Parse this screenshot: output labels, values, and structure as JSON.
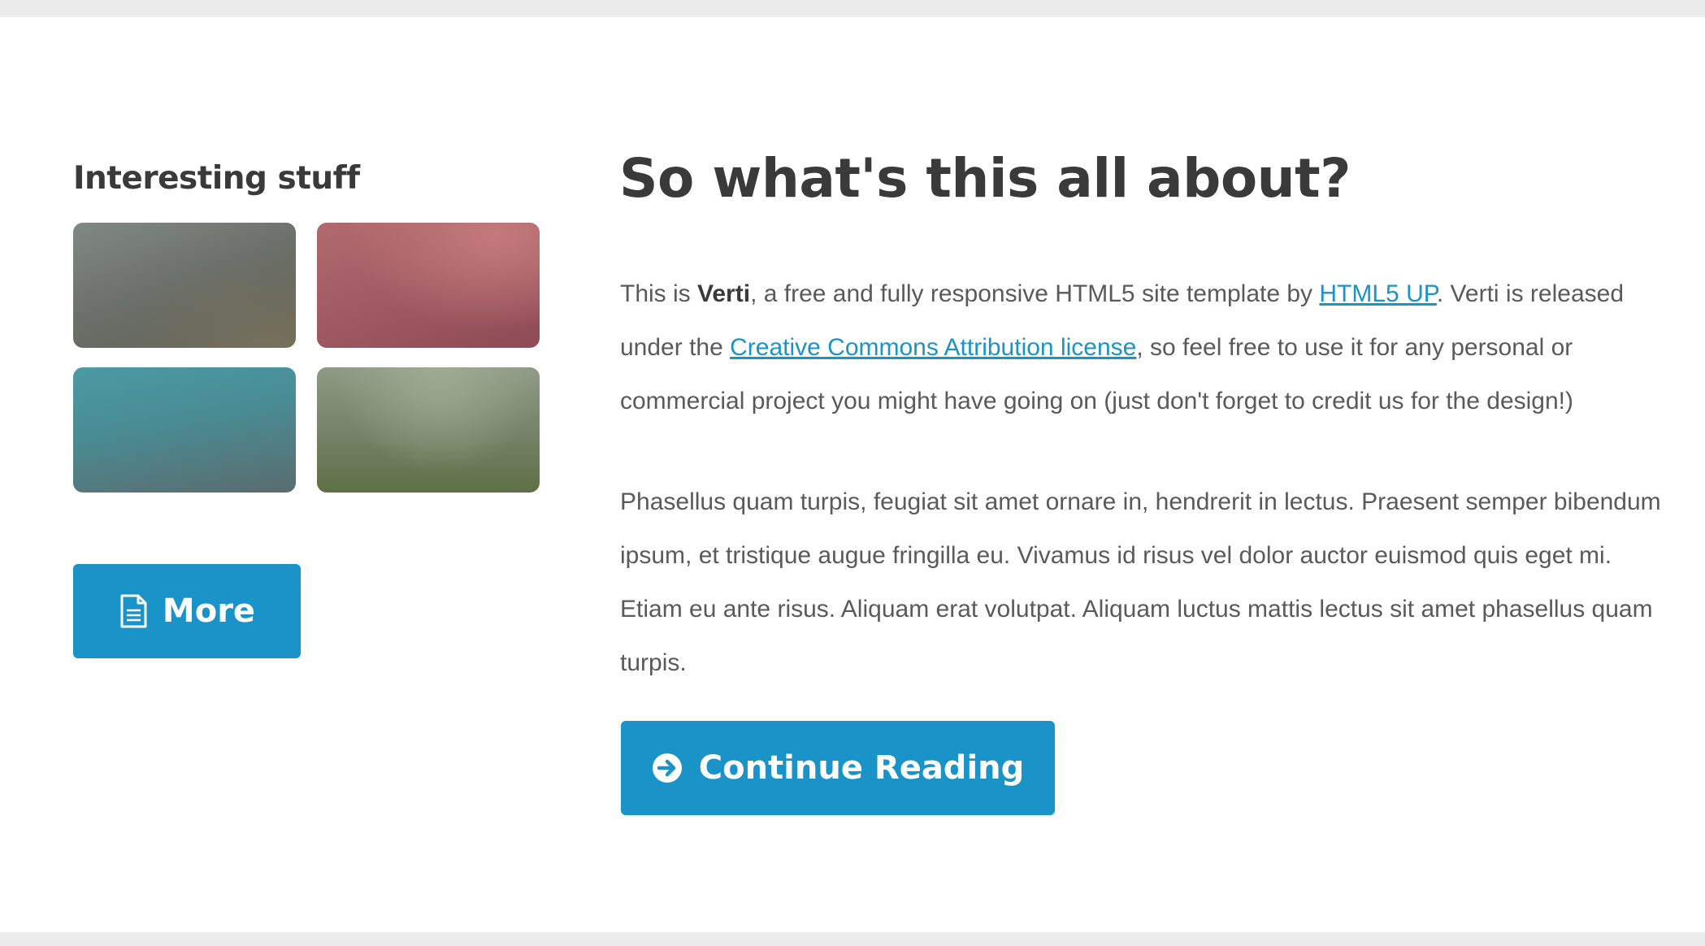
{
  "sidebar": {
    "title": "Interesting stuff",
    "thumbnails": [
      {
        "color": "#6f736c"
      },
      {
        "color": "#a45c65"
      },
      {
        "color": "#4b8a92"
      },
      {
        "color": "#7b8770"
      }
    ],
    "more_button": {
      "label": "More",
      "icon": "document-icon"
    }
  },
  "main": {
    "title": "So what's this all about?",
    "paragraph1": {
      "text_before_brand": "This is ",
      "brand": "Verti",
      "text_after_brand": ", a free and fully responsive HTML5 site template by ",
      "link1": "HTML5 UP",
      "text_after_link1": ". Verti is released under the ",
      "link2": "Creative Commons Attribution license",
      "text_after_link2": ", so feel free to use it for any personal or commercial project you might have going on (just don't forget to credit us for the design!)"
    },
    "paragraph2": "Phasellus quam turpis, feugiat sit amet ornare in, hendrerit in lectus. Praesent semper bibendum ipsum, et tristique augue fringilla eu. Vivamus id risus vel dolor auctor euismod quis eget mi. Etiam eu ante risus. Aliquam erat volutpat. Aliquam luctus mattis lectus sit amet phasellus quam turpis.",
    "continue_button": {
      "label": "Continue Reading",
      "icon": "arrow-circle-right-icon"
    }
  },
  "colors": {
    "accent": "#1a93c8",
    "page_background": "#ececec",
    "content_background": "#ffffff",
    "heading": "#3a3a3a",
    "body_text": "#5a5a5a"
  }
}
